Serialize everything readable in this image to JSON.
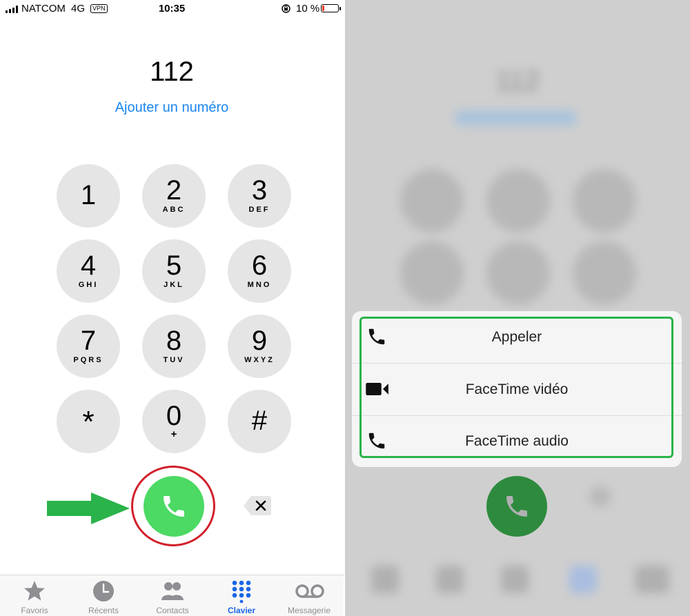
{
  "status_bar": {
    "carrier": "NATCOM",
    "network": "4G",
    "vpn": "VPN",
    "time": "10:35",
    "battery_percent": "10 %"
  },
  "dialer": {
    "entered_number": "112",
    "add_number_link": "Ajouter un numéro",
    "keys": [
      {
        "digit": "1",
        "letters": ""
      },
      {
        "digit": "2",
        "letters": "ABC"
      },
      {
        "digit": "3",
        "letters": "DEF"
      },
      {
        "digit": "4",
        "letters": "GHI"
      },
      {
        "digit": "5",
        "letters": "JKL"
      },
      {
        "digit": "6",
        "letters": "MNO"
      },
      {
        "digit": "7",
        "letters": "PQRS"
      },
      {
        "digit": "8",
        "letters": "TUV"
      },
      {
        "digit": "9",
        "letters": "WXYZ"
      },
      {
        "digit": "*",
        "letters": ""
      },
      {
        "digit": "0",
        "letters": "+"
      },
      {
        "digit": "#",
        "letters": ""
      }
    ]
  },
  "tabbar": {
    "tabs": [
      {
        "label": "Favoris",
        "icon": "star-icon"
      },
      {
        "label": "Récents",
        "icon": "clock-icon"
      },
      {
        "label": "Contacts",
        "icon": "contacts-icon"
      },
      {
        "label": "Clavier",
        "icon": "keypad-icon",
        "active": true
      },
      {
        "label": "Messagerie",
        "icon": "voicemail-icon"
      }
    ]
  },
  "call_menu": {
    "items": [
      {
        "label": "Appeler",
        "icon": "phone-icon"
      },
      {
        "label": "FaceTime vidéo",
        "icon": "video-camera-icon"
      },
      {
        "label": "FaceTime audio",
        "icon": "phone-icon"
      }
    ]
  },
  "colors": {
    "call_green": "#4cd964",
    "link_blue": "#1a86f0",
    "highlight_red": "#d21f2a",
    "annotation_green": "#2ab34a",
    "active_tab_blue": "#1a66e8"
  }
}
